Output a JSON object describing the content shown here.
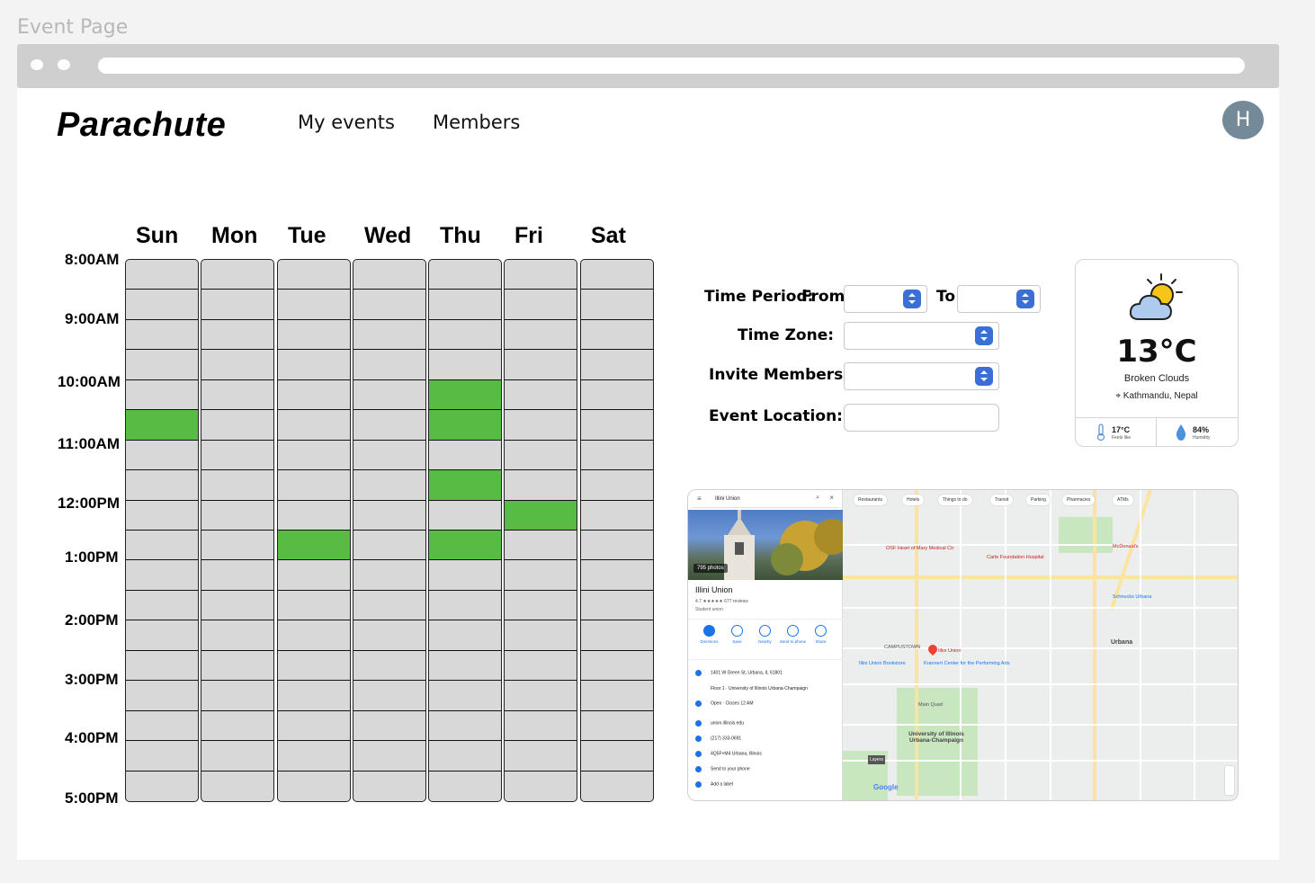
{
  "frame": {
    "title": "Event Page"
  },
  "header": {
    "logo": "Parachute",
    "nav": [
      "My events",
      "Members"
    ],
    "avatar_initial": "H"
  },
  "calendar": {
    "days": [
      "Sun",
      "Mon",
      "Tue",
      "Wed",
      "Thu",
      "Fri",
      "Sat"
    ],
    "times": [
      "8:00AM",
      "9:00AM",
      "10:00AM",
      "11:00AM",
      "12:00PM",
      "1:00PM",
      "2:00PM",
      "3:00PM",
      "4:00PM",
      "5:00PM"
    ],
    "slots_per_day": 18,
    "selected": {
      "Sun": [
        5
      ],
      "Tue": [
        9
      ],
      "Thu": [
        4,
        5,
        7,
        9
      ],
      "Fri": [
        8
      ]
    },
    "selected_color": "#58bb43",
    "empty_color": "#d8d8d8"
  },
  "form": {
    "time_period_label": "Time Period:",
    "from_label": "From",
    "to_label": "To",
    "time_zone_label": "Time Zone:",
    "invite_members_label": "Invite Members:",
    "event_location_label": "Event Location:",
    "accent": "#3b6fd6"
  },
  "weather": {
    "temperature": "13°C",
    "description": "Broken Clouds",
    "location": "Kathmandu, Nepal",
    "feels_like": "17°C",
    "feels_like_label": "Feels like",
    "humidity": "84%",
    "humidity_label": "Humidity",
    "icon": "partly-cloudy-icon"
  },
  "map": {
    "search_text": "Illini Union",
    "photo_count": "795 photos",
    "place_name": "Illini Union",
    "rating_line": "4.7 ★★★★★ 677 reviews",
    "place_type": "Student union",
    "actions": [
      "Directions",
      "Save",
      "Nearby",
      "Send to phone",
      "Share"
    ],
    "info": [
      "1401 W Green St, Urbana, IL 61801",
      "Floor 1 · University of Illinois Urbana-Champaign",
      "Open · Closes 12 AM",
      "union.illinois.edu",
      "(217) 333-0691",
      "4Q5F+M4 Urbana, Illinois",
      "Send to your phone",
      "Add a label"
    ],
    "chips": [
      "Restaurants",
      "Hotels",
      "Things to do",
      "Transit",
      "Parking",
      "Pharmacies",
      "ATMs"
    ],
    "labels": {
      "urbana": "Urbana",
      "campustown": "CAMPUSTOWN",
      "university": "University of Illinois Urbana-Champaign",
      "illini_union": "Illini Union",
      "krannert": "Krannert Center for the Performing Arts",
      "osf": "OSF Heart of Mary Medical Ctr",
      "carle": "Carle Foundation Hospital",
      "schnucks": "Schnucks Urbana",
      "mcdonalds": "McDonald's",
      "bookstore": "Illini Union Bookstore",
      "main_quad": "Main Quad",
      "google": "Google"
    }
  }
}
